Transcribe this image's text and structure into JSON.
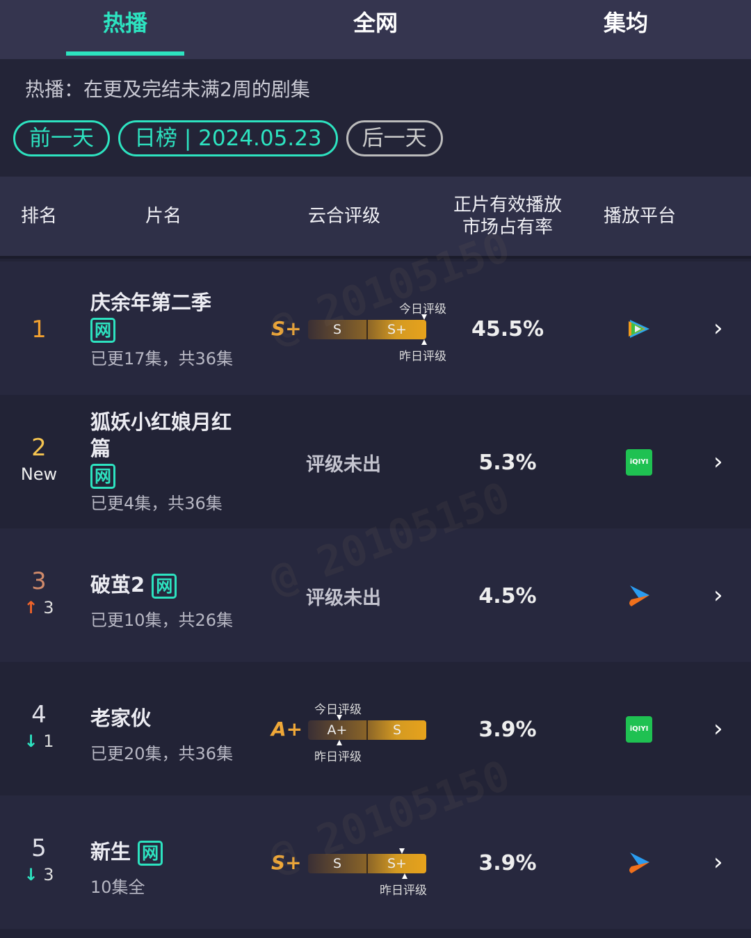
{
  "tabs": [
    "热播",
    "全网",
    "集均"
  ],
  "description": "热播：在更及完结未满2周的剧集",
  "nav": {
    "prev": "前一天",
    "date": "日榜 | 2024.05.23",
    "next": "后一天"
  },
  "columns": [
    "排名",
    "片名",
    "云合评级",
    "正片有效播放\n市场占有率",
    "播放平台"
  ],
  "grade_labels": {
    "today": "今日评级",
    "yesterday": "昨日评级"
  },
  "tag": "网",
  "rows": [
    {
      "rank": "1",
      "change": "",
      "name": "庆余年第二季",
      "episodes": "已更17集，共36集",
      "grade": "S+",
      "bar": [
        "S",
        "S+"
      ],
      "share": "45.5%",
      "platform": "tencent-video"
    },
    {
      "rank": "2",
      "change": "New",
      "name": "狐妖小红娘月红篇",
      "episodes": "已更4集，共36集",
      "grade_none": "评级未出",
      "share": "5.3%",
      "platform": "iqiyi"
    },
    {
      "rank": "3",
      "change": "3",
      "name": "破茧2",
      "episodes": "已更10集，共26集",
      "grade_none": "评级未出",
      "share": "4.5%",
      "platform": "youku"
    },
    {
      "rank": "4",
      "change": "1",
      "name": "老家伙",
      "episodes": "已更20集，共36集",
      "grade": "A+",
      "bar": [
        "A+",
        "S"
      ],
      "share": "3.9%",
      "platform": "iqiyi"
    },
    {
      "rank": "5",
      "change": "3",
      "name": "新生",
      "episodes": "10集全",
      "grade": "S+",
      "bar": [
        "S",
        "S+"
      ],
      "share": "3.9%",
      "platform": "youku"
    }
  ],
  "iqiyi_text": "iQIYI",
  "watermark": "@ 20105150",
  "colors": {
    "accent": "#2de3c0",
    "rank1": "#f0a030",
    "rank2": "#f5c450",
    "rank3": "#d08a6a",
    "up": "#f0642a",
    "down": "#2de3c0"
  }
}
